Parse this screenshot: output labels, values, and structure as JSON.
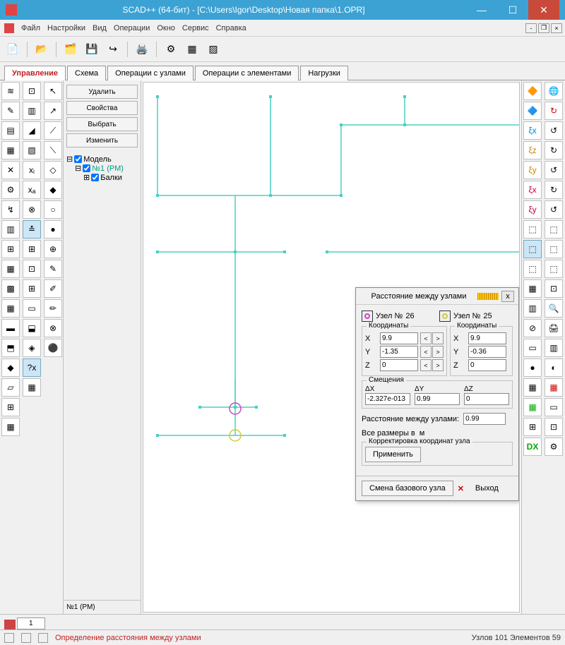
{
  "title": "SCAD++ (64-бит) - [C:\\Users\\Igor\\Desktop\\Новая папка\\1.OPR]",
  "menubar": {
    "file": "Файл",
    "settings": "Настройки",
    "view": "Вид",
    "ops": "Операции",
    "window": "Окно",
    "service": "Сервис",
    "help": "Справка"
  },
  "tabs": {
    "manage": "Управление",
    "schema": "Схема",
    "node_ops": "Операции с узлами",
    "elem_ops": "Операции с элементами",
    "loads": "Нагрузки"
  },
  "tree": {
    "btn_delete": "Удалить",
    "btn_props": "Свойства",
    "btn_select": "Выбрать",
    "btn_edit": "Изменить",
    "root": "Модель",
    "child1": "№1 (РМ)",
    "child2": "Балки",
    "footer": "№1 (РМ)"
  },
  "dialog": {
    "title": "Расстояние между узлами",
    "node_label": "Узел №",
    "node_a": "26",
    "node_b": "25",
    "coords_label": "Координаты",
    "x": "X",
    "y": "Y",
    "z": "Z",
    "a": {
      "x": "9.9",
      "y": "-1.35",
      "z": "0"
    },
    "b": {
      "x": "9.9",
      "y": "-0.36",
      "z": "0"
    },
    "offsets_label": "Смещения",
    "dx_label": "ΔX",
    "dy_label": "ΔY",
    "dz_label": "ΔZ",
    "dx": "-2.327e-013",
    "dy": "0.99",
    "dz": "0",
    "dist_label": "Расстояние между узлами:",
    "dist": "0.99",
    "units_label": "Все размеры в",
    "units": "м",
    "adjust_label": "Корректировка координат узла",
    "apply": "Применить",
    "change_base": "Смена базового узла",
    "exit": "Выход"
  },
  "bottom_tab": "1",
  "status": {
    "msg": "Определение расстояния между узлами",
    "counts": "Узлов 101 Элементов 59"
  },
  "right_dx": "DX"
}
